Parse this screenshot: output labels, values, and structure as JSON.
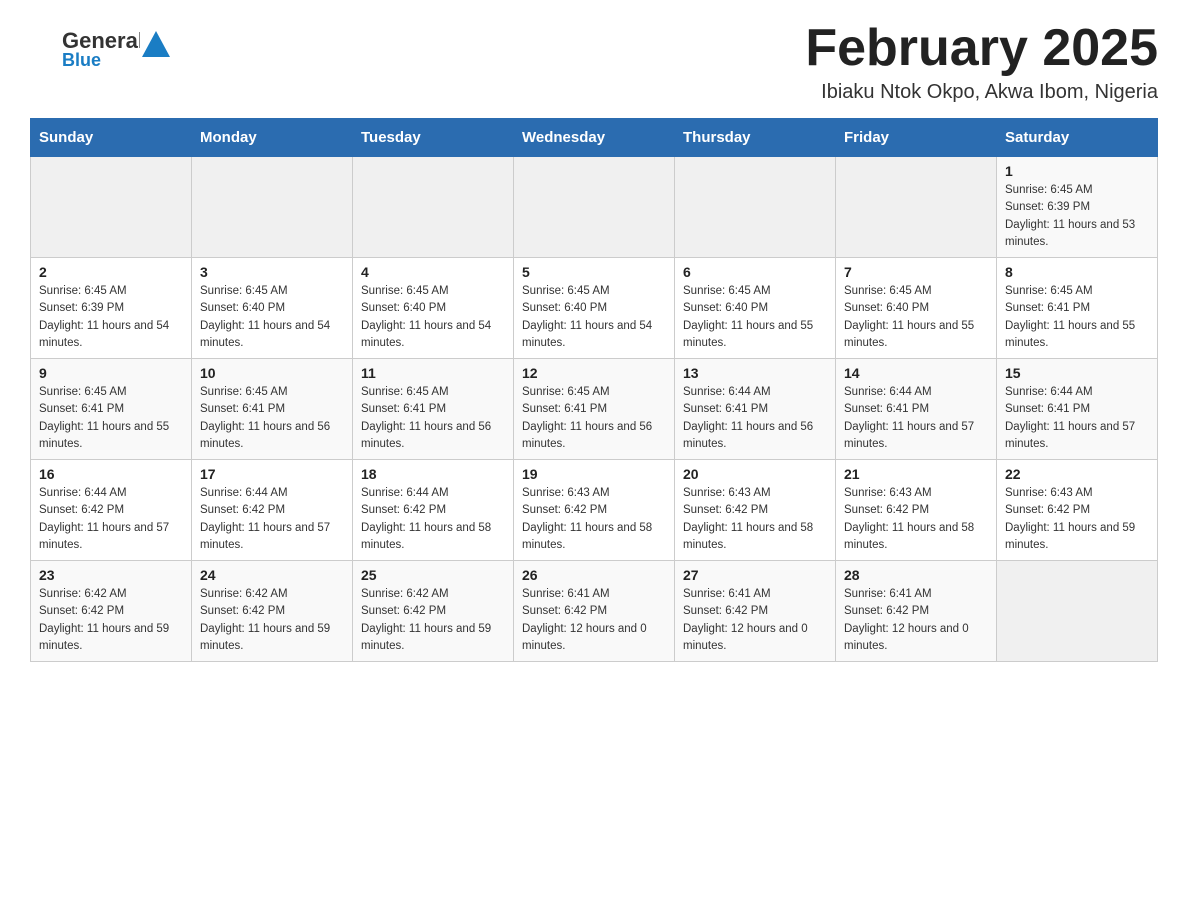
{
  "header": {
    "logo": {
      "text_general": "General",
      "text_blue": "Blue",
      "arrow_color": "#1a7dc4"
    },
    "title": "February 2025",
    "subtitle": "Ibiaku Ntok Okpo, Akwa Ibom, Nigeria"
  },
  "days_of_week": [
    "Sunday",
    "Monday",
    "Tuesday",
    "Wednesday",
    "Thursday",
    "Friday",
    "Saturday"
  ],
  "weeks": [
    [
      {
        "day": "",
        "sunrise": "",
        "sunset": "",
        "daylight": ""
      },
      {
        "day": "",
        "sunrise": "",
        "sunset": "",
        "daylight": ""
      },
      {
        "day": "",
        "sunrise": "",
        "sunset": "",
        "daylight": ""
      },
      {
        "day": "",
        "sunrise": "",
        "sunset": "",
        "daylight": ""
      },
      {
        "day": "",
        "sunrise": "",
        "sunset": "",
        "daylight": ""
      },
      {
        "day": "",
        "sunrise": "",
        "sunset": "",
        "daylight": ""
      },
      {
        "day": "1",
        "sunrise": "Sunrise: 6:45 AM",
        "sunset": "Sunset: 6:39 PM",
        "daylight": "Daylight: 11 hours and 53 minutes."
      }
    ],
    [
      {
        "day": "2",
        "sunrise": "Sunrise: 6:45 AM",
        "sunset": "Sunset: 6:39 PM",
        "daylight": "Daylight: 11 hours and 54 minutes."
      },
      {
        "day": "3",
        "sunrise": "Sunrise: 6:45 AM",
        "sunset": "Sunset: 6:40 PM",
        "daylight": "Daylight: 11 hours and 54 minutes."
      },
      {
        "day": "4",
        "sunrise": "Sunrise: 6:45 AM",
        "sunset": "Sunset: 6:40 PM",
        "daylight": "Daylight: 11 hours and 54 minutes."
      },
      {
        "day": "5",
        "sunrise": "Sunrise: 6:45 AM",
        "sunset": "Sunset: 6:40 PM",
        "daylight": "Daylight: 11 hours and 54 minutes."
      },
      {
        "day": "6",
        "sunrise": "Sunrise: 6:45 AM",
        "sunset": "Sunset: 6:40 PM",
        "daylight": "Daylight: 11 hours and 55 minutes."
      },
      {
        "day": "7",
        "sunrise": "Sunrise: 6:45 AM",
        "sunset": "Sunset: 6:40 PM",
        "daylight": "Daylight: 11 hours and 55 minutes."
      },
      {
        "day": "8",
        "sunrise": "Sunrise: 6:45 AM",
        "sunset": "Sunset: 6:41 PM",
        "daylight": "Daylight: 11 hours and 55 minutes."
      }
    ],
    [
      {
        "day": "9",
        "sunrise": "Sunrise: 6:45 AM",
        "sunset": "Sunset: 6:41 PM",
        "daylight": "Daylight: 11 hours and 55 minutes."
      },
      {
        "day": "10",
        "sunrise": "Sunrise: 6:45 AM",
        "sunset": "Sunset: 6:41 PM",
        "daylight": "Daylight: 11 hours and 56 minutes."
      },
      {
        "day": "11",
        "sunrise": "Sunrise: 6:45 AM",
        "sunset": "Sunset: 6:41 PM",
        "daylight": "Daylight: 11 hours and 56 minutes."
      },
      {
        "day": "12",
        "sunrise": "Sunrise: 6:45 AM",
        "sunset": "Sunset: 6:41 PM",
        "daylight": "Daylight: 11 hours and 56 minutes."
      },
      {
        "day": "13",
        "sunrise": "Sunrise: 6:44 AM",
        "sunset": "Sunset: 6:41 PM",
        "daylight": "Daylight: 11 hours and 56 minutes."
      },
      {
        "day": "14",
        "sunrise": "Sunrise: 6:44 AM",
        "sunset": "Sunset: 6:41 PM",
        "daylight": "Daylight: 11 hours and 57 minutes."
      },
      {
        "day": "15",
        "sunrise": "Sunrise: 6:44 AM",
        "sunset": "Sunset: 6:41 PM",
        "daylight": "Daylight: 11 hours and 57 minutes."
      }
    ],
    [
      {
        "day": "16",
        "sunrise": "Sunrise: 6:44 AM",
        "sunset": "Sunset: 6:42 PM",
        "daylight": "Daylight: 11 hours and 57 minutes."
      },
      {
        "day": "17",
        "sunrise": "Sunrise: 6:44 AM",
        "sunset": "Sunset: 6:42 PM",
        "daylight": "Daylight: 11 hours and 57 minutes."
      },
      {
        "day": "18",
        "sunrise": "Sunrise: 6:44 AM",
        "sunset": "Sunset: 6:42 PM",
        "daylight": "Daylight: 11 hours and 58 minutes."
      },
      {
        "day": "19",
        "sunrise": "Sunrise: 6:43 AM",
        "sunset": "Sunset: 6:42 PM",
        "daylight": "Daylight: 11 hours and 58 minutes."
      },
      {
        "day": "20",
        "sunrise": "Sunrise: 6:43 AM",
        "sunset": "Sunset: 6:42 PM",
        "daylight": "Daylight: 11 hours and 58 minutes."
      },
      {
        "day": "21",
        "sunrise": "Sunrise: 6:43 AM",
        "sunset": "Sunset: 6:42 PM",
        "daylight": "Daylight: 11 hours and 58 minutes."
      },
      {
        "day": "22",
        "sunrise": "Sunrise: 6:43 AM",
        "sunset": "Sunset: 6:42 PM",
        "daylight": "Daylight: 11 hours and 59 minutes."
      }
    ],
    [
      {
        "day": "23",
        "sunrise": "Sunrise: 6:42 AM",
        "sunset": "Sunset: 6:42 PM",
        "daylight": "Daylight: 11 hours and 59 minutes."
      },
      {
        "day": "24",
        "sunrise": "Sunrise: 6:42 AM",
        "sunset": "Sunset: 6:42 PM",
        "daylight": "Daylight: 11 hours and 59 minutes."
      },
      {
        "day": "25",
        "sunrise": "Sunrise: 6:42 AM",
        "sunset": "Sunset: 6:42 PM",
        "daylight": "Daylight: 11 hours and 59 minutes."
      },
      {
        "day": "26",
        "sunrise": "Sunrise: 6:41 AM",
        "sunset": "Sunset: 6:42 PM",
        "daylight": "Daylight: 12 hours and 0 minutes."
      },
      {
        "day": "27",
        "sunrise": "Sunrise: 6:41 AM",
        "sunset": "Sunset: 6:42 PM",
        "daylight": "Daylight: 12 hours and 0 minutes."
      },
      {
        "day": "28",
        "sunrise": "Sunrise: 6:41 AM",
        "sunset": "Sunset: 6:42 PM",
        "daylight": "Daylight: 12 hours and 0 minutes."
      },
      {
        "day": "",
        "sunrise": "",
        "sunset": "",
        "daylight": ""
      }
    ]
  ]
}
